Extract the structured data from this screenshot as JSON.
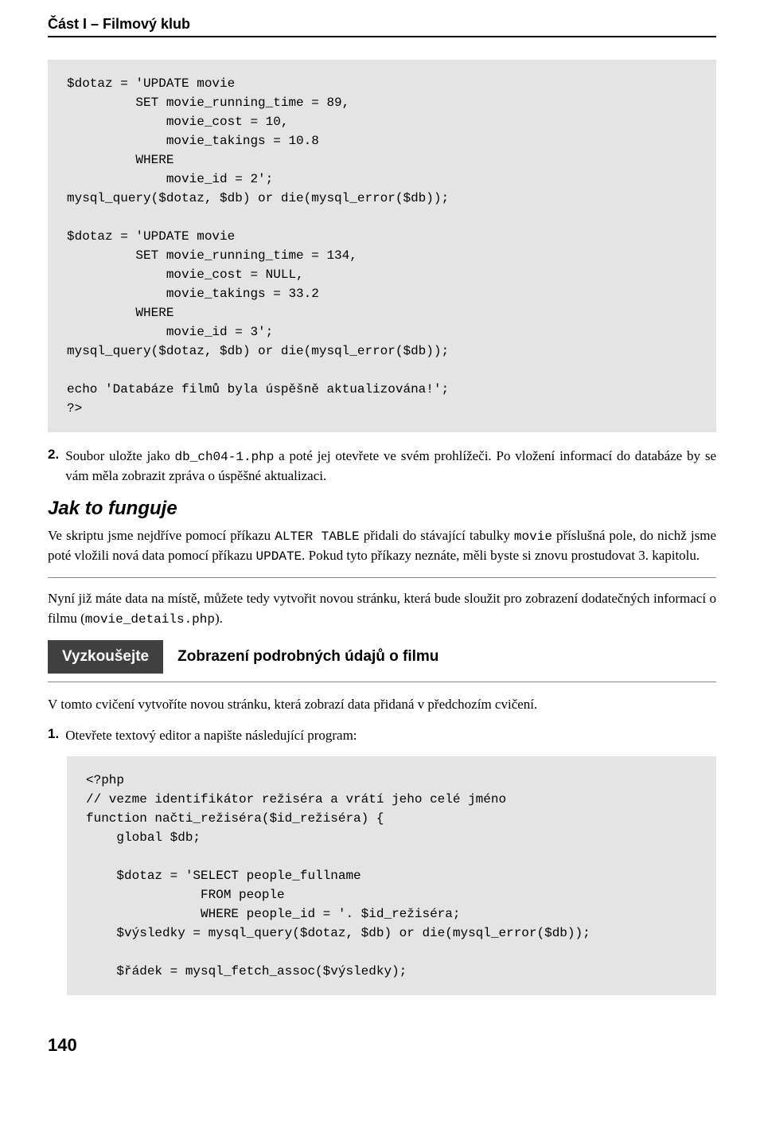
{
  "header": {
    "title": "Část I – Filmový klub"
  },
  "code1": "$dotaz = 'UPDATE movie\n         SET movie_running_time = 89,\n             movie_cost = 10,\n             movie_takings = 10.8\n         WHERE\n             movie_id = 2';\nmysql_query($dotaz, $db) or die(mysql_error($db));\n\n$dotaz = 'UPDATE movie\n         SET movie_running_time = 134,\n             movie_cost = NULL,\n             movie_takings = 33.2\n         WHERE\n             movie_id = 3';\nmysql_query($dotaz, $db) or die(mysql_error($db));\n\necho 'Databáze filmů byla úspěšně aktualizována!';\n?>",
  "step2": {
    "num": "2.",
    "t1": "Soubor uložte jako ",
    "file": "db_ch04-1.php",
    "t2": " a poté jej otevřete ve svém prohlížeči. Po vložení informací do databáze by se vám měla zobrazit zpráva o úspěšné aktualizaci."
  },
  "howItWorks": {
    "heading": "Jak to funguje",
    "p_a": "Ve skriptu jsme nejdříve pomocí příkazu ",
    "c1": "ALTER TABLE",
    "p_b": " přidali do stávající tabulky ",
    "c2": "movie",
    "p_c": " příslušná pole, do nichž jsme poté vložili nová data pomocí příkazu ",
    "c3": "UPDATE",
    "p_d": ". Pokud tyto příkazy neznáte, měli byste si znovu prostudovat 3. kapitolu."
  },
  "bridge": {
    "a": "Nyní již máte data na místě, můžete tedy vytvořit novou stránku, která bude sloužit pro zobrazení dodatečných informací o filmu (",
    "c": "movie_details.php",
    "b": ")."
  },
  "try": {
    "label": "Vyzkoušejte",
    "title": "Zobrazení podrobných údajů o filmu"
  },
  "try_intro": "V tomto cvičení vytvoříte novou stránku, která zobrazí data přidaná v předchozím cvičení.",
  "step1b": {
    "num": "1.",
    "text": "Otevřete textový editor a napište následující program:"
  },
  "code2": "<?php\n// vezme identifikátor režiséra a vrátí jeho celé jméno\nfunction načti_režiséra($id_režiséra) {\n    global $db;\n\n    $dotaz = 'SELECT people_fullname\n               FROM people\n               WHERE people_id = '. $id_režiséra;\n    $výsledky = mysql_query($dotaz, $db) or die(mysql_error($db));\n\n    $řádek = mysql_fetch_assoc($výsledky);",
  "pageNum": "140"
}
